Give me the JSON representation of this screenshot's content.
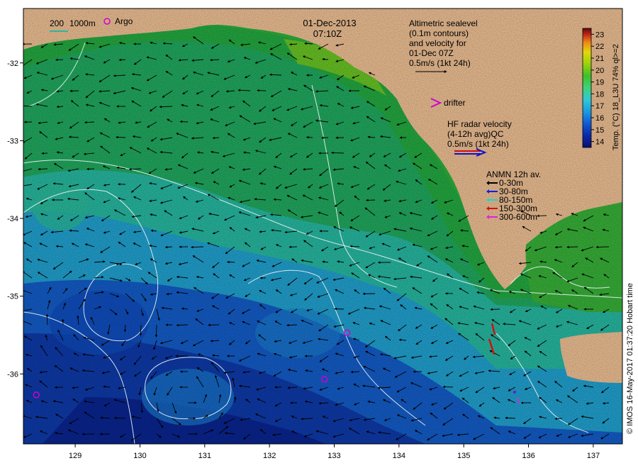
{
  "header": {
    "date": "01-Dec-2013",
    "time": "07:10Z"
  },
  "scale_bar": {
    "label_200": "200",
    "label_1000": "1000m",
    "color": "#2fb5a0"
  },
  "argo": {
    "label": "Argo",
    "color": "#d000d0",
    "floats": [
      {
        "lon": 129.5,
        "lat": -31.55
      },
      {
        "lon": 128.4,
        "lat": -36.27
      },
      {
        "lon": 132.85,
        "lat": -36.07
      },
      {
        "lon": 133.2,
        "lat": -35.47
      }
    ]
  },
  "altimetry_box": {
    "lines": [
      "Altimetric sealevel",
      "(0.1m contours)",
      "and velocity for",
      "01-Dec 07Z",
      "0.5m/s (1kt 24h)"
    ]
  },
  "drifter": {
    "label": "drifter",
    "color": "#d000d0"
  },
  "hf_radar": {
    "lines": [
      "HF radar velocity",
      "(4-12h avg)QC",
      "0.5m/s (1kt 24h)"
    ],
    "colors": [
      "#d01010",
      "#1010d0"
    ]
  },
  "anmn": {
    "title": "ANMN 12h av.",
    "items": [
      {
        "label": "0-30m",
        "color": "#000000"
      },
      {
        "label": "30-80m",
        "color": "#1020e0"
      },
      {
        "label": "80-150m",
        "color": "#20d0d0"
      },
      {
        "label": "150-300m",
        "color": "#d01010"
      },
      {
        "label": "300-600m",
        "color": "#e020e0"
      }
    ]
  },
  "colorbar": {
    "title": "Temp. (°C) 18_L3U 74% ql>=2",
    "ticks": [
      "23",
      "22",
      "21",
      "20",
      "19",
      "18",
      "17",
      "16",
      "15",
      "14"
    ],
    "min": 13.5,
    "max": 23.5,
    "colors": [
      "#08106e",
      "#0a2aa8",
      "#0f5ad6",
      "#1a9ae0",
      "#30c8d8",
      "#3fd27a",
      "#3ec02a",
      "#9ad20c",
      "#e0d80c",
      "#f08a18",
      "#c02418",
      "#5c0a08"
    ]
  },
  "credit": "© IMOS 16-May-2017 01:37:20 Hobart time",
  "axes": {
    "x_ticks": [
      "129",
      "130",
      "131",
      "132",
      "133",
      "134",
      "135",
      "136",
      "137"
    ],
    "y_ticks": [
      "-32",
      "-33",
      "-34",
      "-35",
      "-36"
    ],
    "lon_range": [
      128.2,
      137.45
    ],
    "lat_range": [
      -36.9,
      -31.3
    ]
  },
  "colors": {
    "land": "#f8c89a",
    "hf_radar_red": "#d01010",
    "drifter_magenta": "#d000d0",
    "contour": "#e8f4f4"
  }
}
